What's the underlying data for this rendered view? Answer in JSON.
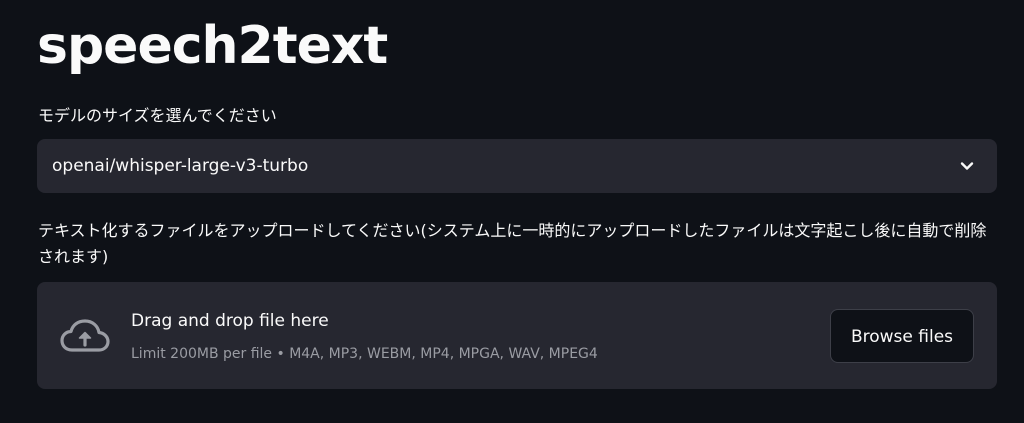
{
  "app": {
    "title": "speech2text"
  },
  "model": {
    "label": "モデルのサイズを選んでください",
    "selected": "openai/whisper-large-v3-turbo",
    "dropdown_icon": "chevron-down-icon"
  },
  "upload": {
    "label": "テキスト化するファイルをアップロードしてください(システム上に一時的にアップロードしたファイルは文字起こし後に自動で削除されます)",
    "drop_title": "Drag and drop file here",
    "limits": "Limit 200MB per file • M4A, MP3, WEBM, MP4, MPGA, WAV, MPEG4",
    "browse_label": "Browse files",
    "icon": "cloud-upload-icon"
  },
  "colors": {
    "background": "#0e1117",
    "widget": "#262730",
    "text": "#fafafa",
    "muted_text": "#9a9ca3"
  }
}
